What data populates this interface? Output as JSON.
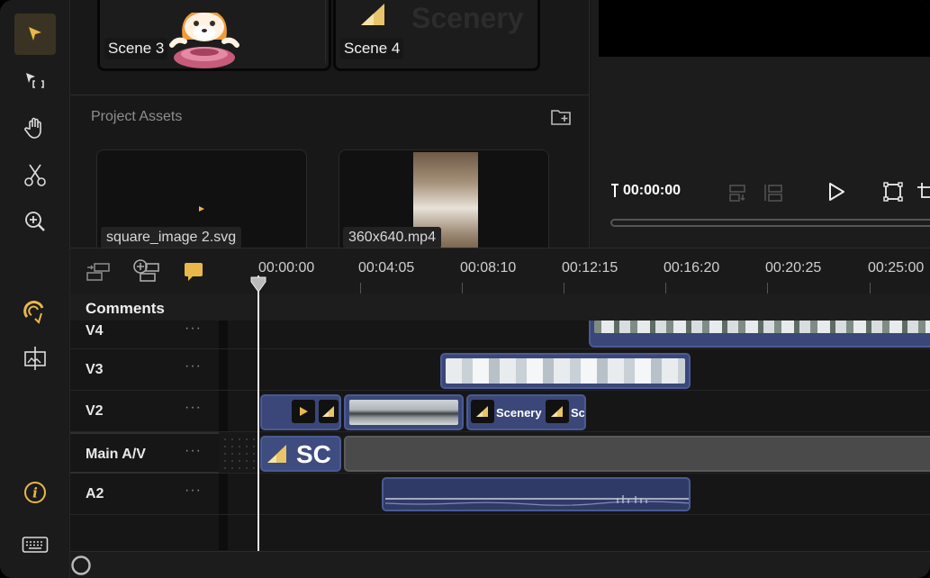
{
  "toolbar": {
    "tools": [
      "select-arrow-icon",
      "select-range-icon",
      "hand-icon",
      "scissors-icon",
      "zoom-in-icon",
      "magnet-icon",
      "split-view-icon"
    ],
    "bottom": [
      "info-icon",
      "keyboard-icon"
    ]
  },
  "media": {
    "scenes": [
      {
        "label": "Scene 3"
      },
      {
        "label": "Scene 4",
        "preview_text": "Scenery"
      }
    ],
    "assets_title": "Project Assets",
    "assets": [
      {
        "label": "square_image 2.svg"
      },
      {
        "label": "360x640.mp4"
      }
    ]
  },
  "preview": {
    "timecode": "00:00:00"
  },
  "timeline": {
    "ruler_labels": [
      "00:00:00",
      "00:04:05",
      "00:08:10",
      "00:12:15",
      "00:16:20",
      "00:20:25",
      "00:25:00"
    ],
    "comments_label": "Comments",
    "tracks": [
      {
        "name": "V4",
        "menu": "···"
      },
      {
        "name": "V3",
        "menu": "···"
      },
      {
        "name": "V2",
        "menu": "···"
      },
      {
        "name": "Main A/V",
        "menu": "···"
      },
      {
        "name": "A2",
        "menu": "···"
      }
    ],
    "clip_texts": {
      "scenery_a": "Scenery",
      "scenery_b": "Sc",
      "main_title": "SC"
    }
  },
  "colors": {
    "accent": "#e8b84a",
    "clip_blue": "#3a4778",
    "clip_border": "#4a5a93"
  }
}
